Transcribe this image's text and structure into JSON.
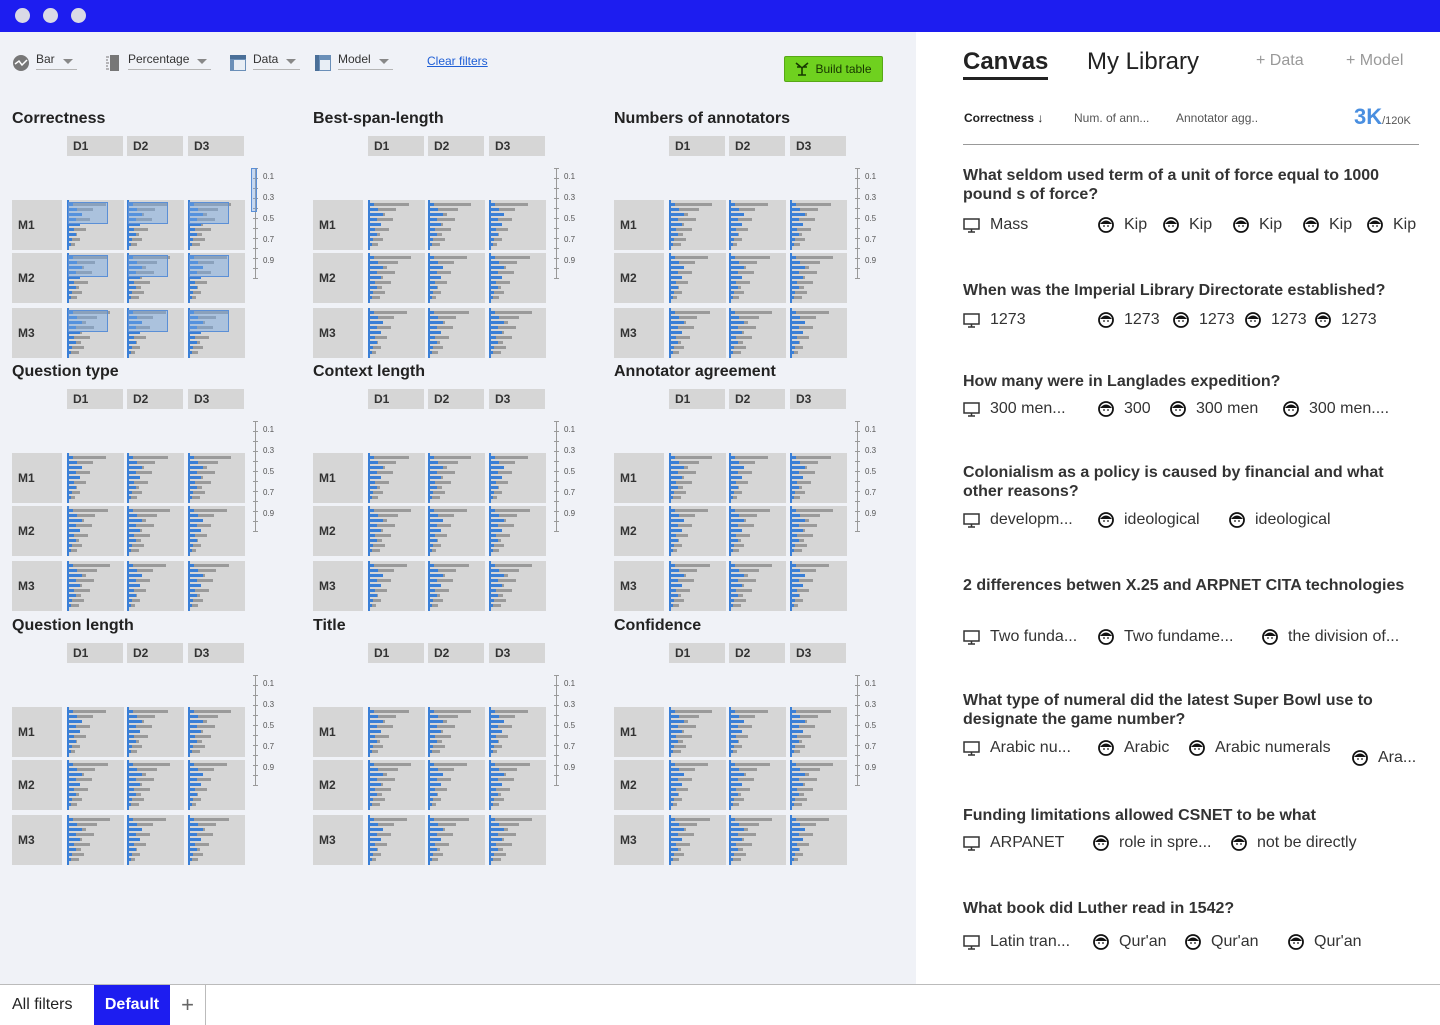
{
  "colors": {
    "titlebar": "#1d1df0",
    "bar_primary": "#3a7fd6",
    "bar_secondary": "#9a9a9a",
    "build_button": "#6fd11f",
    "count": "#4a8fe0"
  },
  "toolbar": {
    "chart_type": {
      "label": "Bar",
      "icon": "chart-type-icon"
    },
    "value_mode": {
      "label": "Percentage",
      "icon": "ruler-icon"
    },
    "data": {
      "label": "Data",
      "icon": "data-table-icon"
    },
    "model": {
      "label": "Model",
      "icon": "model-table-icon"
    },
    "clear_filters": "Clear filters",
    "build_table": "Build table"
  },
  "grid": {
    "columns": [
      "D1",
      "D2",
      "D3"
    ],
    "rows": [
      "M1",
      "M2",
      "M3"
    ],
    "scale_ticks": [
      "0.1",
      "0.3",
      "0.5",
      "0.7",
      "0.9"
    ]
  },
  "charts": [
    {
      "title": "Correctness",
      "selected": true
    },
    {
      "title": "Best-span-length"
    },
    {
      "title": "Numbers of annotators"
    },
    {
      "title": "Question type"
    },
    {
      "title": "Context length"
    },
    {
      "title": "Annotator agreement"
    },
    {
      "title": "Question length"
    },
    {
      "title": "Title"
    },
    {
      "title": "Confidence"
    }
  ],
  "right": {
    "tabs": [
      "Canvas",
      "My Library"
    ],
    "add_data": "Data",
    "add_model": "Model",
    "sort_columns": [
      "Correctness ↓",
      "Num. of ann...",
      "Annotator agg.."
    ],
    "count": "3K",
    "total": "/120K"
  },
  "questions": [
    {
      "text": "What seldom used term of a unit of force equal to 1000 pound s of force?",
      "truth": "Mass",
      "answers": [
        "Kip",
        "Kip",
        "Kip",
        "Kip",
        "Kip"
      ]
    },
    {
      "text": "When was the Imperial Library Directorate established?",
      "truth": "1273",
      "answers": [
        "1273",
        "1273",
        "1273",
        "1273"
      ]
    },
    {
      "text": "How many were in Langlades expedition?",
      "truth": "300 men...",
      "answers": [
        "300",
        "300 men",
        "300 men...."
      ]
    },
    {
      "text": "Colonialism as a policy is caused by financial and what other reasons?",
      "truth": "developm...",
      "answers": [
        "ideological",
        "ideological"
      ]
    },
    {
      "text": "2 differences betwen X.25 and ARPNET CITA technologies",
      "truth": "Two funda...",
      "answers": [
        "Two fundame...",
        "the division of..."
      ]
    },
    {
      "text": "What type of numeral did the latest Super Bowl use to designate the game number?",
      "truth": "Arabic nu...",
      "answers": [
        "Arabic",
        "Arabic numerals",
        "Ara..."
      ]
    },
    {
      "text": "Funding limitations allowed CSNET to be what",
      "truth": "ARPANET",
      "answers": [
        "role in spre...",
        "not be directly"
      ]
    },
    {
      "text": "What book did Luther read in 1542?",
      "truth": "Latin tran...",
      "answers": [
        "Qur'an",
        "Qur'an",
        "Qur'an"
      ]
    }
  ],
  "bottom": {
    "all_filters": "All filters",
    "default_tab": "Default",
    "add_icon": "plus-icon"
  }
}
